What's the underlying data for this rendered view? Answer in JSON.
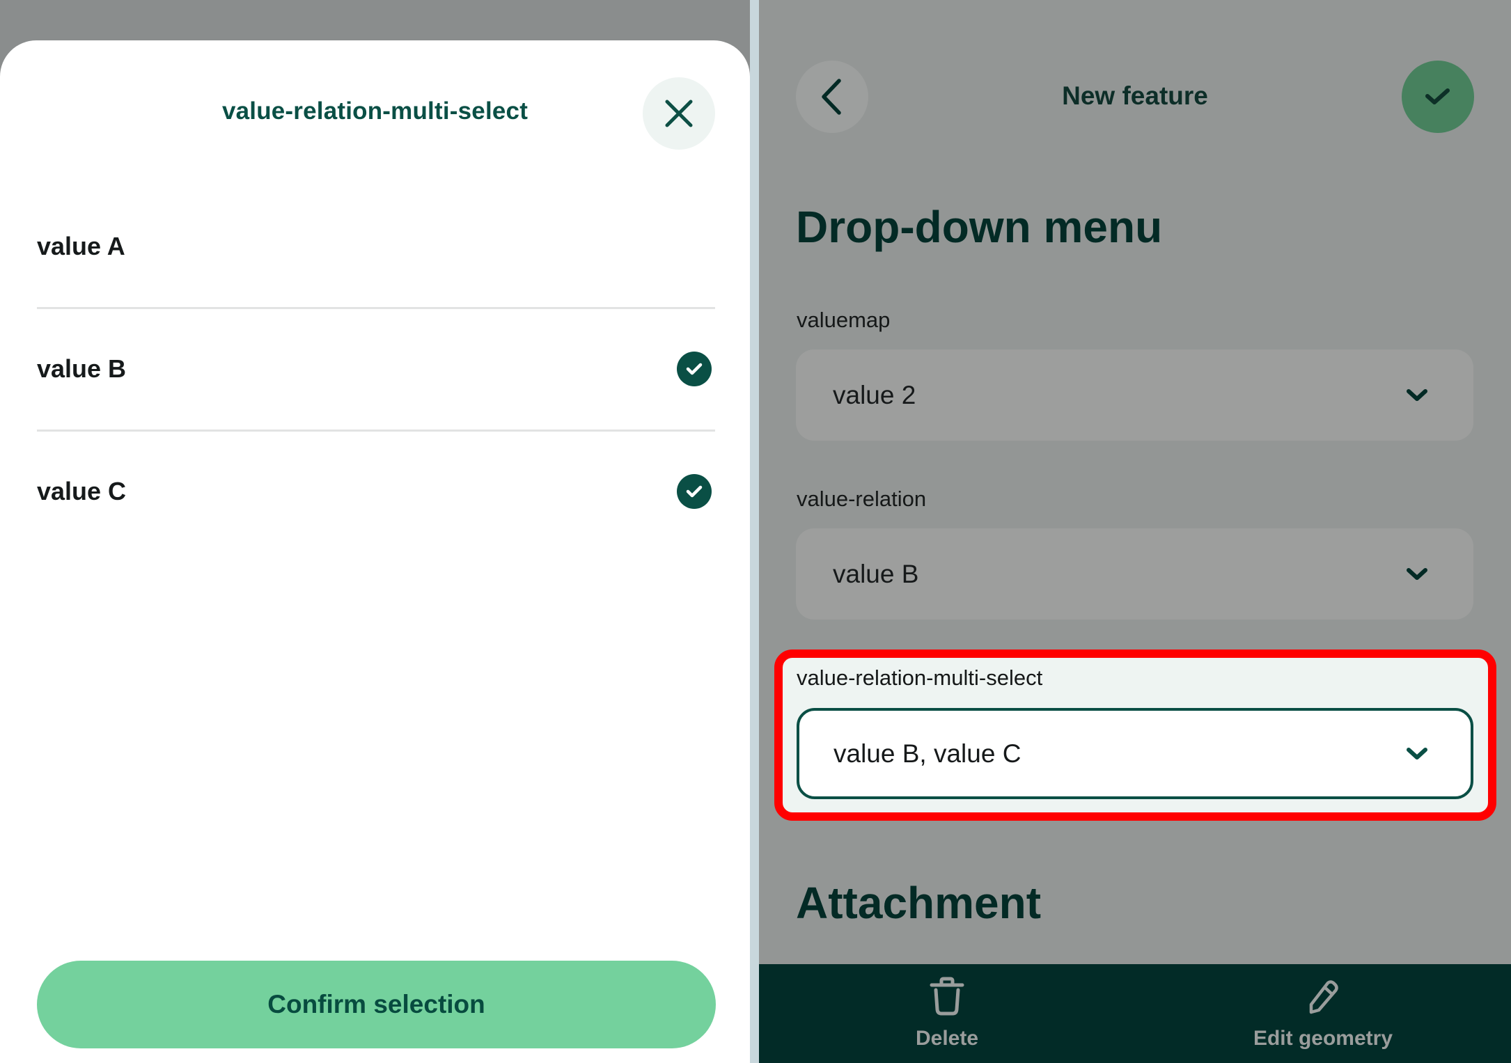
{
  "left_panel": {
    "sheet_title": "value-relation-multi-select",
    "close_icon": "close-icon",
    "options": [
      {
        "label": "value A",
        "selected": false
      },
      {
        "label": "value B",
        "selected": true
      },
      {
        "label": "value C",
        "selected": true
      }
    ],
    "confirm_label": "Confirm selection"
  },
  "right_panel": {
    "header": {
      "back_icon": "chevron-left-icon",
      "title": "New feature",
      "save_icon": "check-icon"
    },
    "sections": [
      {
        "heading": "Drop-down menu",
        "fields": [
          {
            "label": "valuemap",
            "value": "value 2",
            "highlighted": false
          },
          {
            "label": "value-relation",
            "value": "value B",
            "highlighted": false
          },
          {
            "label": "value-relation-multi-select",
            "value": "value B, value C",
            "highlighted": true
          }
        ]
      },
      {
        "heading": "Attachment"
      }
    ],
    "bottom_bar": [
      {
        "label": "Delete",
        "icon": "trash-icon"
      },
      {
        "label": "Edit geometry",
        "icon": "pencil-icon"
      }
    ]
  },
  "colors": {
    "primary_dark": "#0a4f45",
    "accent_green": "#74d19d",
    "save_green": "#47815e",
    "bottom_bar": "#022b27",
    "highlight_red": "#ff0000"
  }
}
